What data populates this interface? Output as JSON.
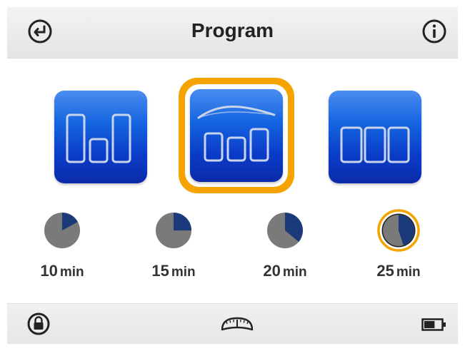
{
  "header": {
    "title": "Program",
    "back_icon": "back-arrow-icon",
    "info_icon": "info-icon"
  },
  "programs": [
    {
      "name": "program-steps",
      "selected": false
    },
    {
      "name": "program-wave",
      "selected": true
    },
    {
      "name": "program-constant",
      "selected": false
    }
  ],
  "timers": [
    {
      "value": "10",
      "unit": "min",
      "fraction": 0.17,
      "selected": false
    },
    {
      "value": "15",
      "unit": "min",
      "fraction": 0.25,
      "selected": false
    },
    {
      "value": "20",
      "unit": "min",
      "fraction": 0.36,
      "selected": false
    },
    {
      "value": "25",
      "unit": "min",
      "fraction": 0.45,
      "selected": true
    }
  ],
  "footer": {
    "lock_icon": "lock-icon",
    "gauge_icon": "scale-gauge-icon",
    "battery_icon": "battery-icon",
    "battery_level": 0.6
  },
  "colors": {
    "accent": "#f5a300",
    "button_blue": "#1565e0",
    "pie_fill": "#1a3a7a",
    "pie_bg": "#7a7a7a"
  }
}
